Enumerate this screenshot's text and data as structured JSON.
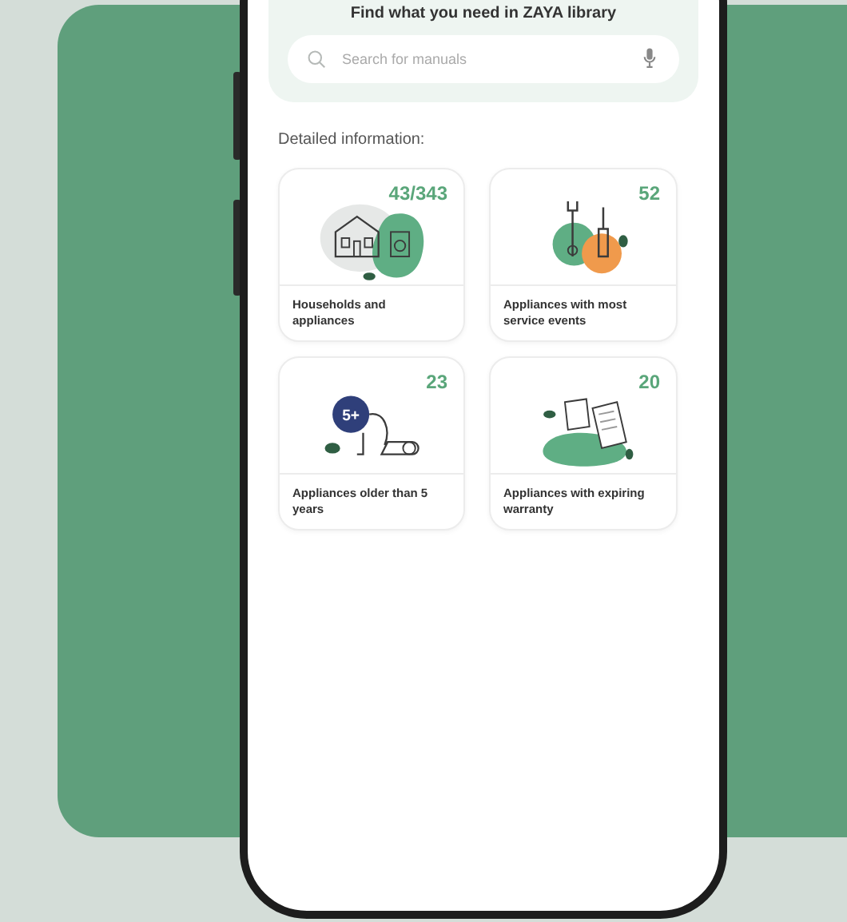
{
  "banner": {
    "title": "Find what you need in ZAYA library"
  },
  "search": {
    "placeholder": "Search for manuals"
  },
  "section_label": "Detailed information:",
  "cards": [
    {
      "kind": "households",
      "count": "43/343",
      "label": "Households and appliances"
    },
    {
      "kind": "service",
      "count": "52",
      "label": "Appliances with most service events"
    },
    {
      "kind": "age",
      "count": "23",
      "label": "Appliances older than 5 years",
      "badge": "5+"
    },
    {
      "kind": "warranty",
      "count": "20",
      "label": "Appliances with expiring warranty"
    }
  ]
}
